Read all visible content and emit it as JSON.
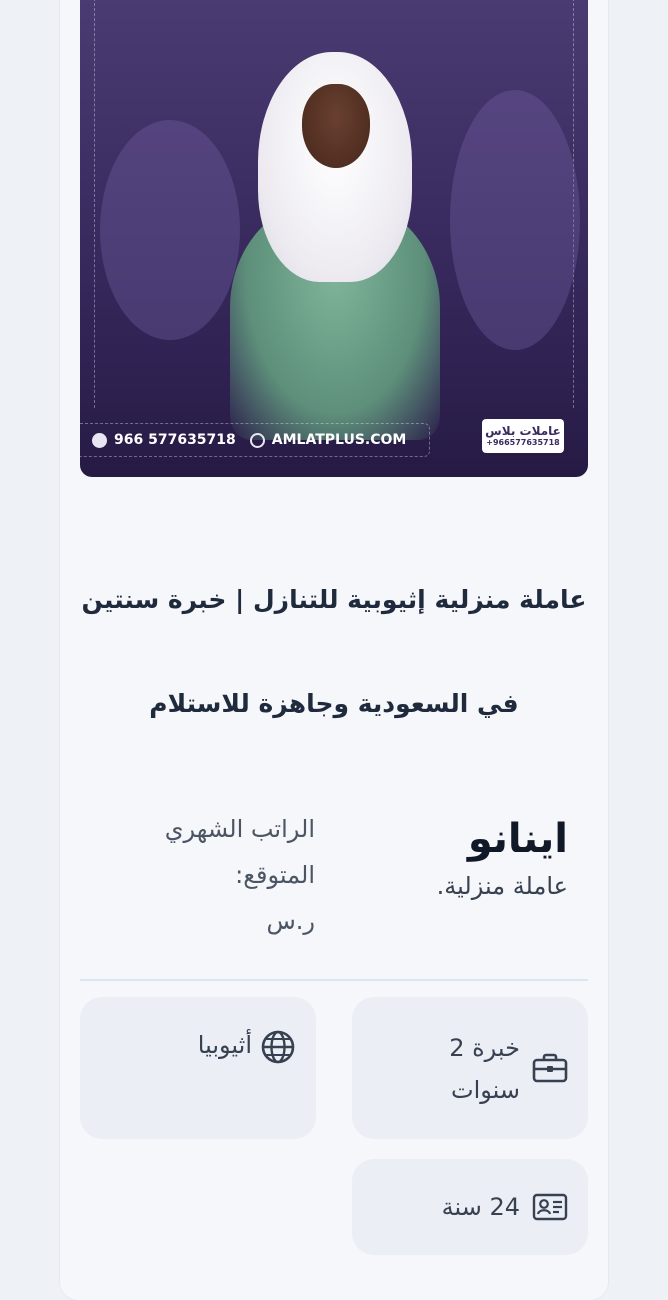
{
  "photo": {
    "phone": "966 577635718",
    "website": "AMLATPLUS.COM",
    "logo_text": "عاملات بلاس",
    "logo_phone": "+966577635718"
  },
  "listing": {
    "title_line1": "عاملة منزلية إثيوبية للتنازل | خبرة سنتين",
    "title_line2": "في السعودية وجاهزة للاستلام",
    "name": "اينانو",
    "role": "عاملة منزلية.",
    "salary_line1": "الراتب الشهري",
    "salary_line2": "المتوقع:",
    "salary_currency": "ر.س"
  },
  "details": {
    "experience_line1": "خبرة 2",
    "experience_line2": "سنوات",
    "country": "أثيوبيا",
    "age": "24 سنة"
  },
  "colors": {
    "accent": "#3a2c60",
    "title": "#1f2a3d",
    "tile_bg": "#ebeff5",
    "divider": "#dbe6f0"
  }
}
